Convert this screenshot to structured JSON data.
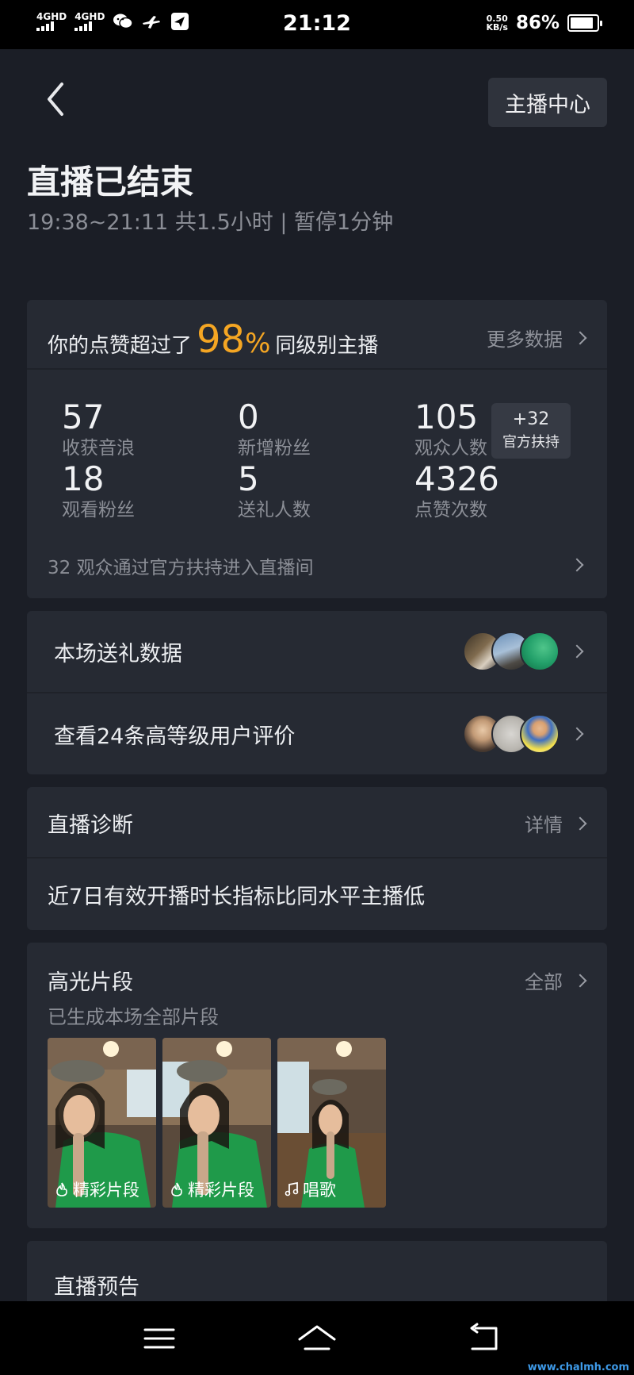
{
  "status_bar": {
    "network_1": "4GHD",
    "network_2": "4GHD",
    "time": "21:12",
    "speed_value": "0.50",
    "speed_unit": "KB/s",
    "battery_pct": "86%",
    "battery_level": 0.86,
    "icons": [
      "wechat-icon",
      "flight-icon",
      "send-icon"
    ]
  },
  "header": {
    "anchor_center_label": "主播中心",
    "title": "直播已结束",
    "subtitle": "19:38~21:11 共1.5小时 | 暂停1分钟"
  },
  "stats_card": {
    "likes_prefix": "你的点赞超过了",
    "likes_pct": "98",
    "likes_pct_sign": "%",
    "likes_suffix": "同级别主播",
    "more_data": "更多数据",
    "items": [
      {
        "num": "57",
        "label": "收获音浪"
      },
      {
        "num": "0",
        "label": "新增粉丝"
      },
      {
        "num": "105",
        "label": "观众人数"
      },
      {
        "num": "18",
        "label": "观看粉丝"
      },
      {
        "num": "5",
        "label": "送礼人数"
      },
      {
        "num": "4326",
        "label": "点赞次数"
      }
    ],
    "support_badge_value": "+32",
    "support_badge_label": "官方扶持",
    "support_note": "32 观众通过官方扶持进入直播间"
  },
  "rows": {
    "gift_data": "本场送礼数据",
    "reviews": "查看24条高等级用户评价"
  },
  "diagnosis": {
    "title": "直播诊断",
    "detail": "详情",
    "text": "近7日有效开播时长指标比同水平主播低"
  },
  "highlights": {
    "title": "高光片段",
    "all": "全部",
    "subtitle": "已生成本场全部片段",
    "clips": [
      {
        "caption": "精彩片段",
        "icon": "clip-icon"
      },
      {
        "caption": "精彩片段",
        "icon": "clip-icon"
      },
      {
        "caption": "唱歌",
        "icon": "music-note-icon"
      }
    ]
  },
  "preview": {
    "title": "直播预告"
  },
  "watermark": "www.chalmh.com",
  "colors": {
    "accent": "#f5a623",
    "background": "#1b1e26",
    "card": "#262a33"
  }
}
